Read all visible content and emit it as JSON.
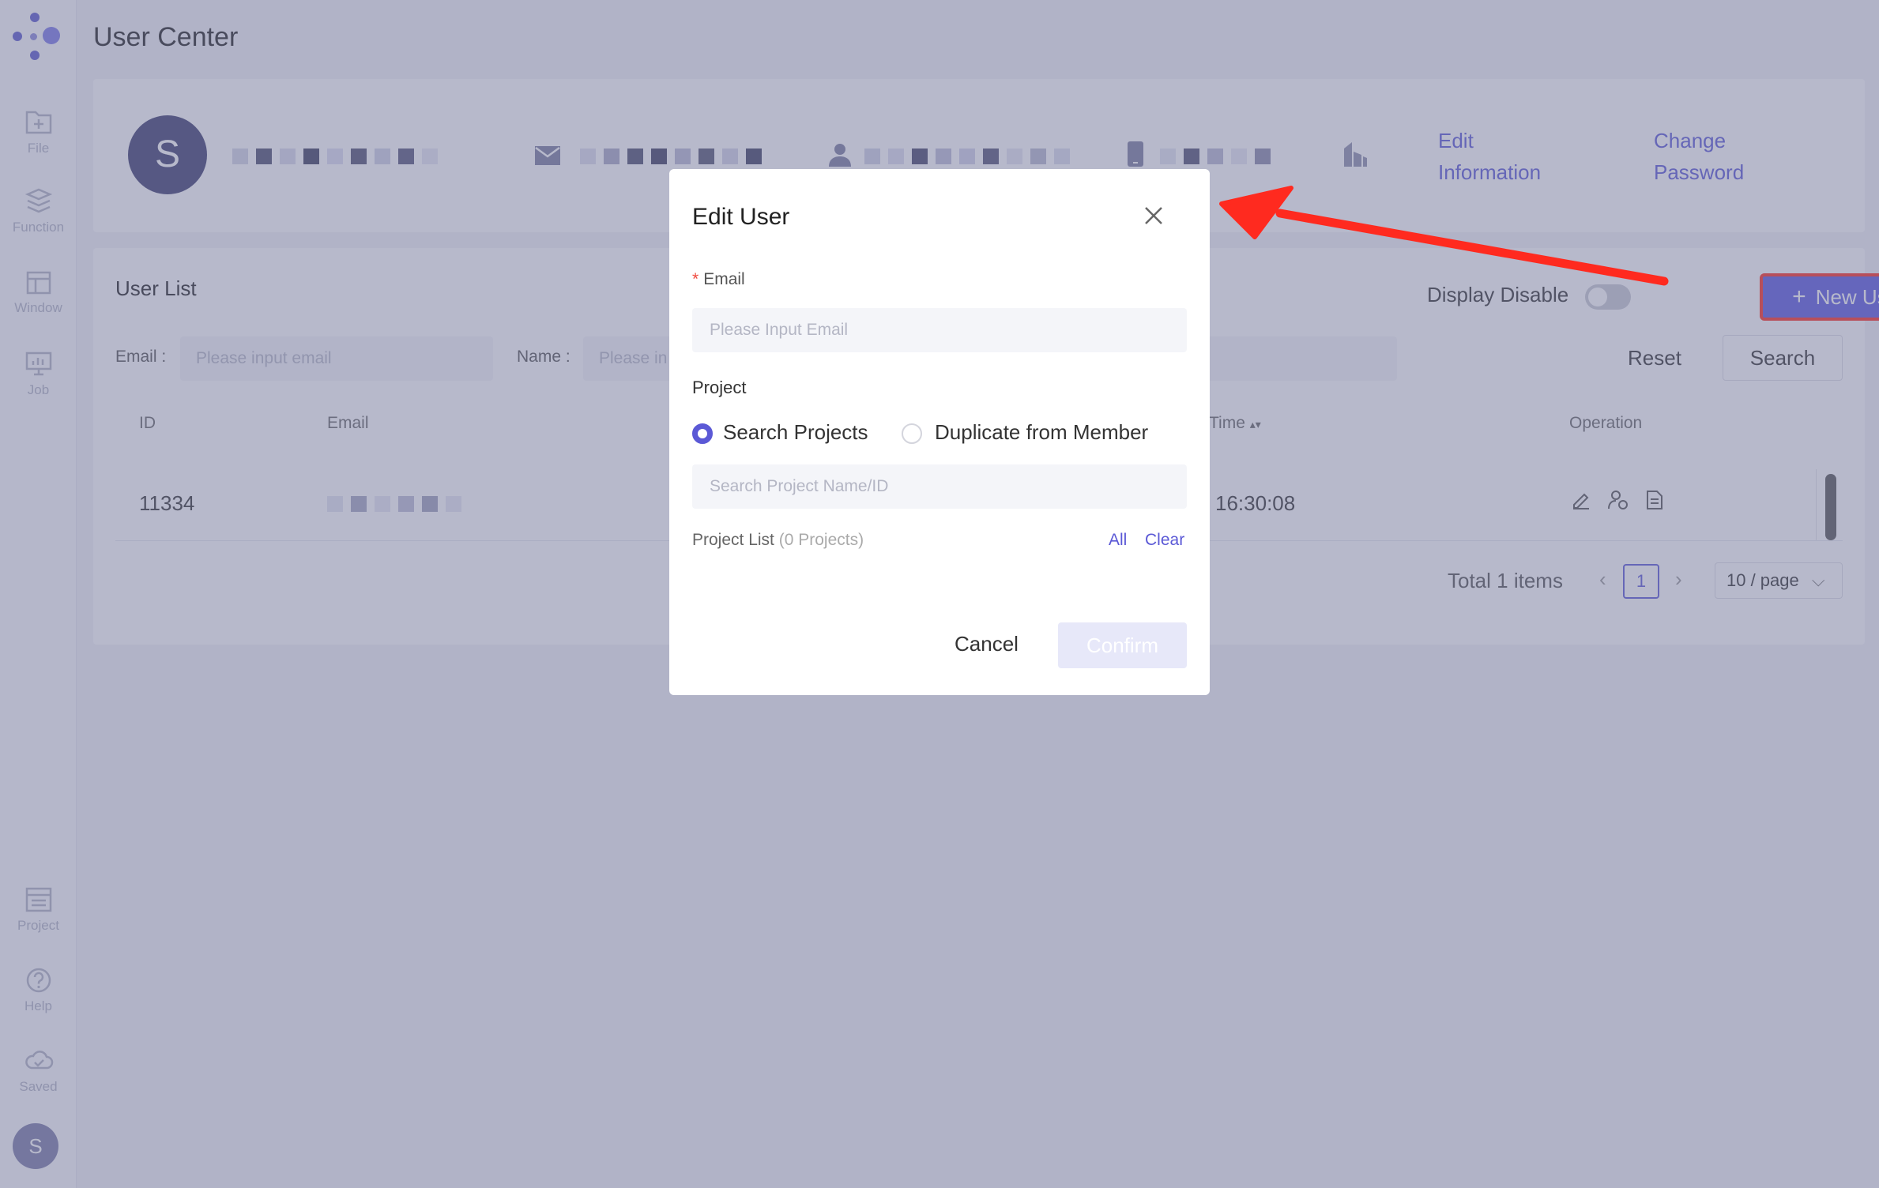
{
  "app": {
    "title": "User Center",
    "avatar_initial": "S"
  },
  "sidebar": {
    "items": [
      {
        "label": "File",
        "icon": "file-add-icon"
      },
      {
        "label": "Function",
        "icon": "function-icon"
      },
      {
        "label": "Window",
        "icon": "window-icon"
      },
      {
        "label": "Job",
        "icon": "job-icon"
      },
      {
        "label": "Project",
        "icon": "project-icon"
      },
      {
        "label": "Help",
        "icon": "help-icon"
      },
      {
        "label": "Saved",
        "icon": "cloud-saved-icon"
      }
    ]
  },
  "profile": {
    "avatar_initial": "S",
    "edit_information": "Edit Information",
    "change_password": "Change Password"
  },
  "user_list": {
    "title": "User List",
    "display_disable_label": "Display Disable",
    "new_user_label": "New User",
    "filters": {
      "email_label": "Email :",
      "email_placeholder": "Please input email",
      "name_label": "Name :",
      "name_placeholder": "Please in"
    },
    "reset_label": "Reset",
    "search_label": "Search",
    "columns": [
      "ID",
      "Email",
      "Time",
      "Operation"
    ],
    "rows": [
      {
        "id": "11334",
        "time": "16:30:08"
      }
    ],
    "pagination": {
      "total": "Total 1 items",
      "current_page": "1",
      "page_size": "10 / page"
    }
  },
  "modal": {
    "title": "Edit User",
    "email_label": "Email",
    "required_mark": "*",
    "email_placeholder": "Please Input Email",
    "project_label": "Project",
    "radio_search": "Search Projects",
    "radio_duplicate": "Duplicate from Member",
    "project_search_placeholder": "Search Project Name/ID",
    "project_list_label": "Project List",
    "project_count": "(0 Projects)",
    "all_label": "All",
    "clear_label": "Clear",
    "cancel_label": "Cancel",
    "confirm_label": "Confirm"
  },
  "colors": {
    "accent": "#5b59d6",
    "annotation": "#ff2a1f"
  }
}
